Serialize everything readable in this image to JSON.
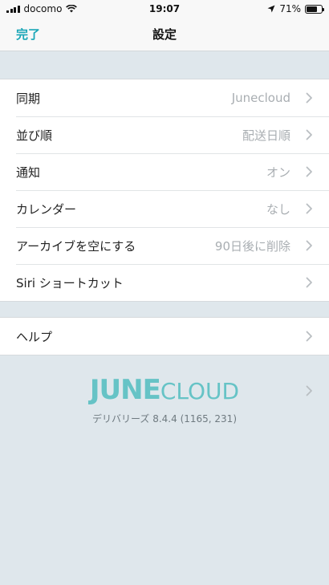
{
  "status_bar": {
    "carrier": "docomo",
    "time": "19:07",
    "battery_text": "71%",
    "battery_level": 0.71
  },
  "nav": {
    "done_label": "完了",
    "title": "設定"
  },
  "settings": [
    {
      "label": "同期",
      "value": "Junecloud"
    },
    {
      "label": "並び順",
      "value": "配送日順"
    },
    {
      "label": "通知",
      "value": "オン"
    },
    {
      "label": "カレンダー",
      "value": "なし"
    },
    {
      "label": "アーカイブを空にする",
      "value": "90日後に削除"
    },
    {
      "label": "Siri ショートカット",
      "value": ""
    }
  ],
  "help": {
    "label": "ヘルプ"
  },
  "footer": {
    "logo_part1": "JUNE",
    "logo_part2": "CLOUD",
    "version": "デリバリーズ 8.4.4 (1165, 231)"
  },
  "colors": {
    "accent": "#1aa6b7",
    "logo": "#66c3c6",
    "background": "#dfe7ec"
  },
  "icons": [
    "wifi-icon",
    "location-arrow-icon",
    "battery-icon",
    "chevron-right-icon"
  ]
}
